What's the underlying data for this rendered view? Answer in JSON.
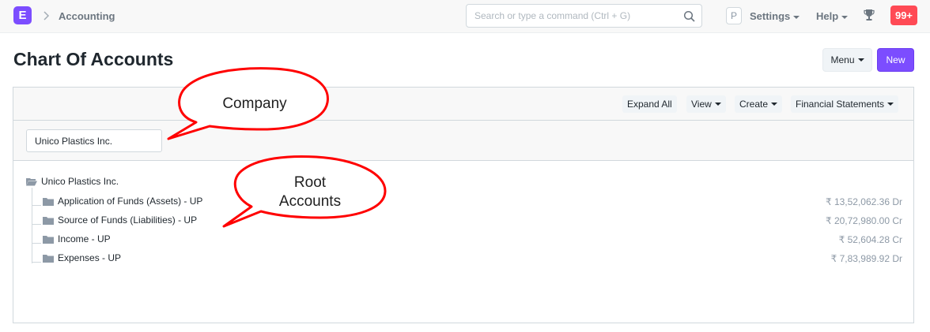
{
  "navbar": {
    "logo_letter": "E",
    "breadcrumb": "Accounting",
    "search_placeholder": "Search or type a command (Ctrl + G)",
    "user_initial": "P",
    "settings_label": "Settings",
    "help_label": "Help",
    "notifications_count": "99+"
  },
  "page": {
    "title": "Chart Of Accounts",
    "menu_label": "Menu",
    "new_label": "New"
  },
  "toolbar": {
    "expand_all": "Expand All",
    "view": "View",
    "create": "Create",
    "financial_statements": "Financial Statements"
  },
  "filter": {
    "company_value": "Unico Plastics Inc."
  },
  "tree": {
    "root": "Unico Plastics Inc.",
    "nodes": [
      {
        "label": "Application of Funds (Assets) - UP",
        "balance": "₹ 13,52,062.36 Dr"
      },
      {
        "label": "Source of Funds (Liabilities) - UP",
        "balance": "₹ 20,72,980.00 Cr"
      },
      {
        "label": "Income - UP",
        "balance": "₹ 52,604.28 Cr"
      },
      {
        "label": "Expenses - UP",
        "balance": "₹ 7,83,989.92 Dr"
      }
    ]
  },
  "annotations": {
    "company_callout": "Company",
    "root_callout_line1": "Root",
    "root_callout_line2": "Accounts"
  },
  "colors": {
    "brand": "#7c4dff",
    "notification": "#ff4a55",
    "callout_stroke": "#ff0000"
  }
}
